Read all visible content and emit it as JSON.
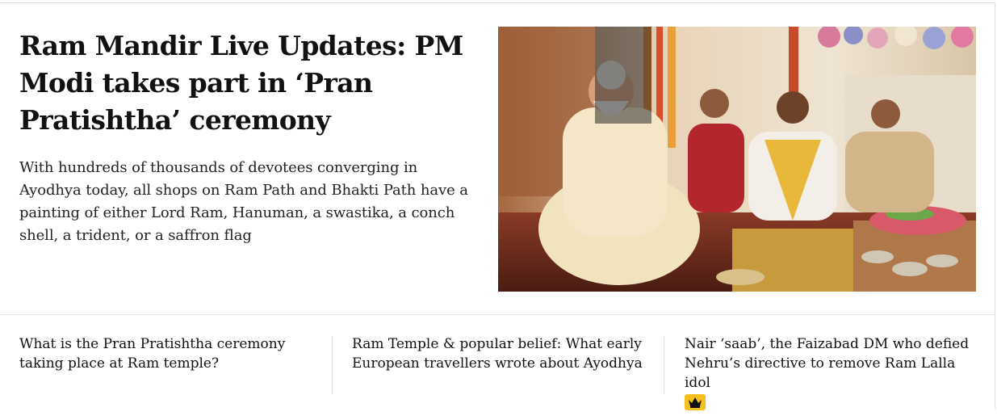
{
  "lead": {
    "headline": "Ram Mandir Live Updates: PM Modi takes part in ‘Pran Pratishtha’ ceremony",
    "summary": "With hundreds of thousands of devotees converging in Ayodhya today, all shops on Ram Path and Bhakti Path have a painting of either Lord Ram, Hanuman, a swastika, a conch shell, a trident, or a saffron flag"
  },
  "related": [
    {
      "title": "What is the Pran Pratishtha ceremony taking place at Ram temple?"
    },
    {
      "title": "Ram Temple & popular belief: What early European travellers wrote about Ayodhya"
    },
    {
      "title": "Nair ‘saab’, the Faizabad DM who defied Nehru’s directive to remove Ram Lalla idol",
      "premium_icon": "crown-icon"
    }
  ],
  "colors": {
    "premium_badge": "#f5bf1d",
    "divider": "#e2e2e2"
  }
}
